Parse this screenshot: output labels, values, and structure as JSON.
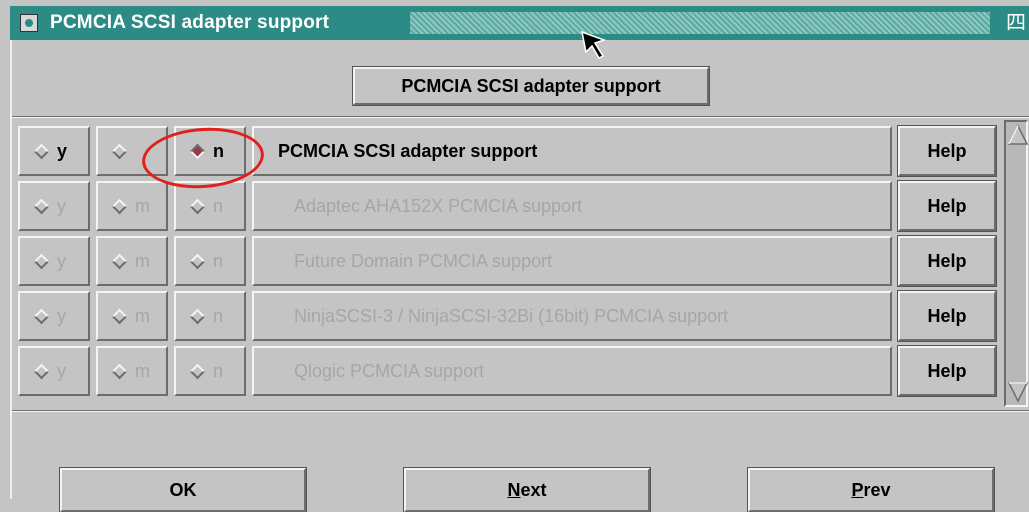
{
  "window": {
    "title": "PCMCIA SCSI adapter support"
  },
  "header_button": "PCMCIA SCSI adapter support",
  "options": [
    {
      "y": "y",
      "m": "",
      "n": "n",
      "selected": "n",
      "label": "PCMCIA SCSI adapter support",
      "enabled": true,
      "help": "Help"
    },
    {
      "y": "y",
      "m": "m",
      "n": "n",
      "selected": "",
      "label": "Adaptec AHA152X PCMCIA support",
      "enabled": false,
      "help": "Help"
    },
    {
      "y": "y",
      "m": "m",
      "n": "n",
      "selected": "",
      "label": "Future Domain PCMCIA support",
      "enabled": false,
      "help": "Help"
    },
    {
      "y": "y",
      "m": "m",
      "n": "n",
      "selected": "",
      "label": "NinjaSCSI-3 / NinjaSCSI-32Bi (16bit) PCMCIA support",
      "enabled": false,
      "help": "Help"
    },
    {
      "y": "y",
      "m": "m",
      "n": "n",
      "selected": "",
      "label": "Qlogic PCMCIA support",
      "enabled": false,
      "help": "Help"
    }
  ],
  "buttons": {
    "ok": "OK",
    "next_mnemonic": "N",
    "next_rest": "ext",
    "prev_mnemonic": "P",
    "prev_rest": "rev"
  },
  "colors": {
    "titlebar": "#2d8b85",
    "selected_radio": "#a0364a",
    "annotation": "#e0201a",
    "disabled_text": "#a6a6a6"
  }
}
